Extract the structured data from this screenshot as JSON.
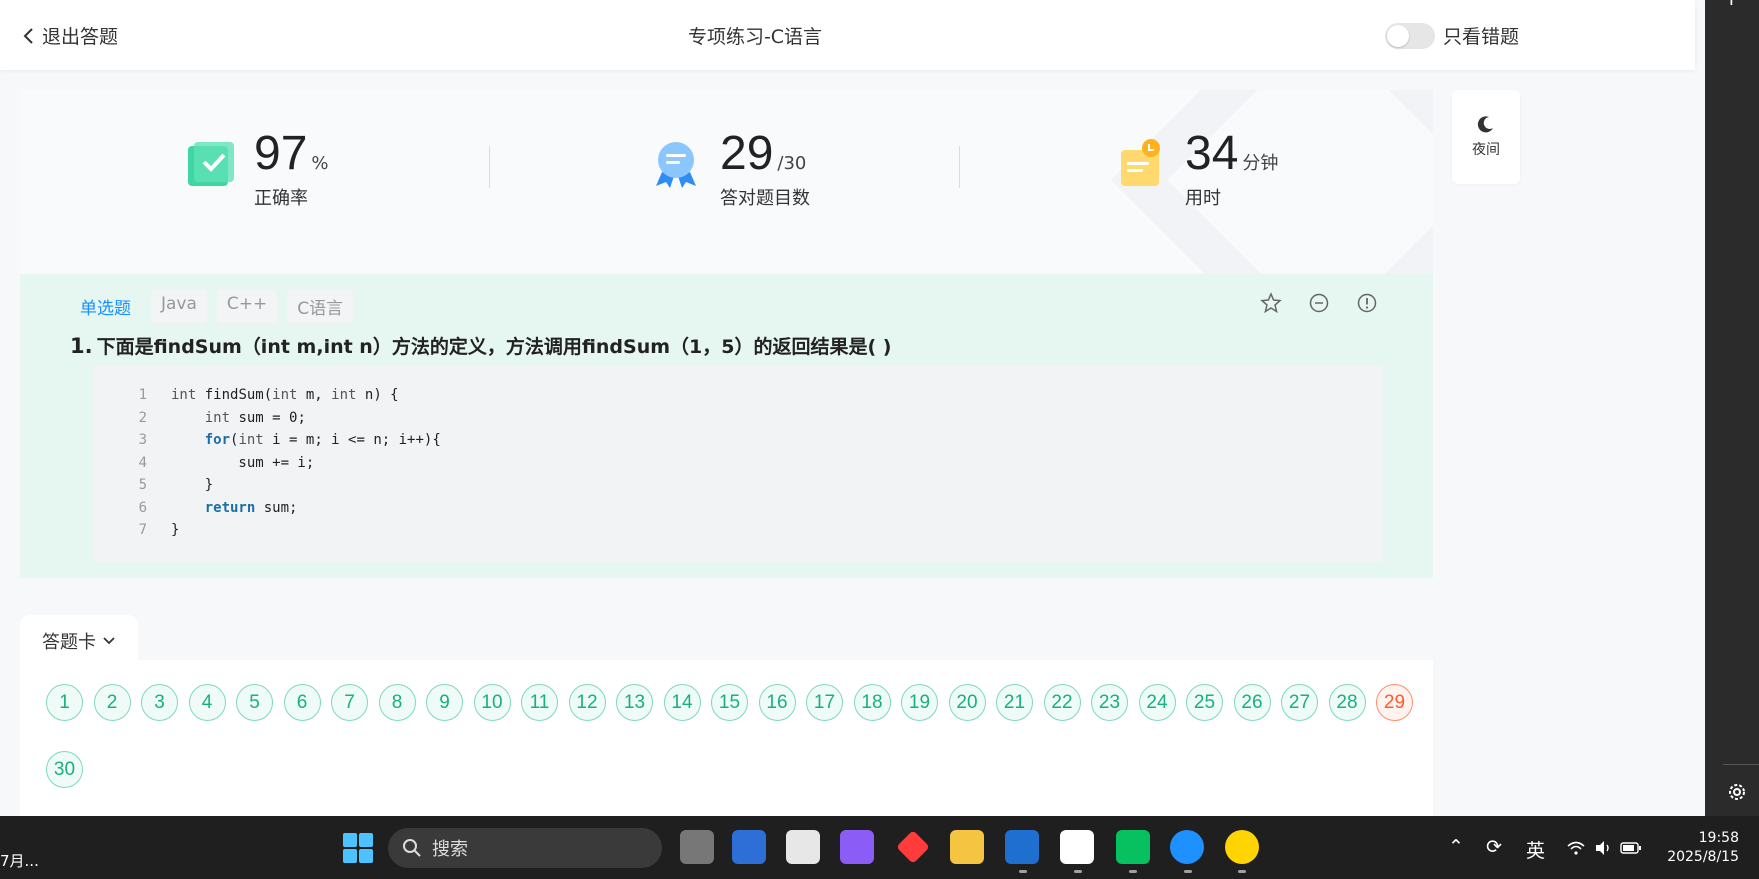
{
  "header": {
    "exit_label": "退出答题",
    "title": "专项练习-C语言",
    "wrong_only_label": "只看错题"
  },
  "stats": {
    "accuracy": {
      "value": "97",
      "unit": "%",
      "label": "正确率"
    },
    "correct": {
      "value": "29",
      "unit": "/30",
      "label": "答对题目数"
    },
    "time": {
      "value": "34",
      "unit": "分钟",
      "label": "用时"
    }
  },
  "night_mode": {
    "label": "夜间"
  },
  "question": {
    "tags": [
      "单选题",
      "Java",
      "C++",
      "C语言"
    ],
    "number": "1.",
    "text": "下面是findSum（int m,int n）方法的定义，方法调用findSum（1，5）的返回结果是( )",
    "code_lines": [
      {
        "n": "1",
        "code": "int findSum(int m, int n) {"
      },
      {
        "n": "2",
        "code": "    int sum = 0;"
      },
      {
        "n": "3",
        "code": "    for(int i = m; i <= n; i++){"
      },
      {
        "n": "4",
        "code": "        sum += i;"
      },
      {
        "n": "5",
        "code": "    }"
      },
      {
        "n": "6",
        "code": "    return sum;"
      },
      {
        "n": "7",
        "code": "}"
      }
    ]
  },
  "answer_card": {
    "label": "答题卡",
    "questions": [
      "1",
      "2",
      "3",
      "4",
      "5",
      "6",
      "7",
      "8",
      "9",
      "10",
      "11",
      "12",
      "13",
      "14",
      "15",
      "16",
      "17",
      "18",
      "19",
      "20",
      "21",
      "22",
      "23",
      "24",
      "25",
      "26",
      "27",
      "28",
      "29",
      "30"
    ],
    "wrong": [
      "29"
    ]
  },
  "taskbar": {
    "left_text": "7月...",
    "search_placeholder": "搜索",
    "ime": "英",
    "time": "19:58",
    "date": "2025/8/15"
  },
  "colors": {
    "accent_green": "#19b07f",
    "wrong_red": "#ff5a2c",
    "question_bg": "#e6f6f1",
    "tag_blue": "#1890ff"
  }
}
